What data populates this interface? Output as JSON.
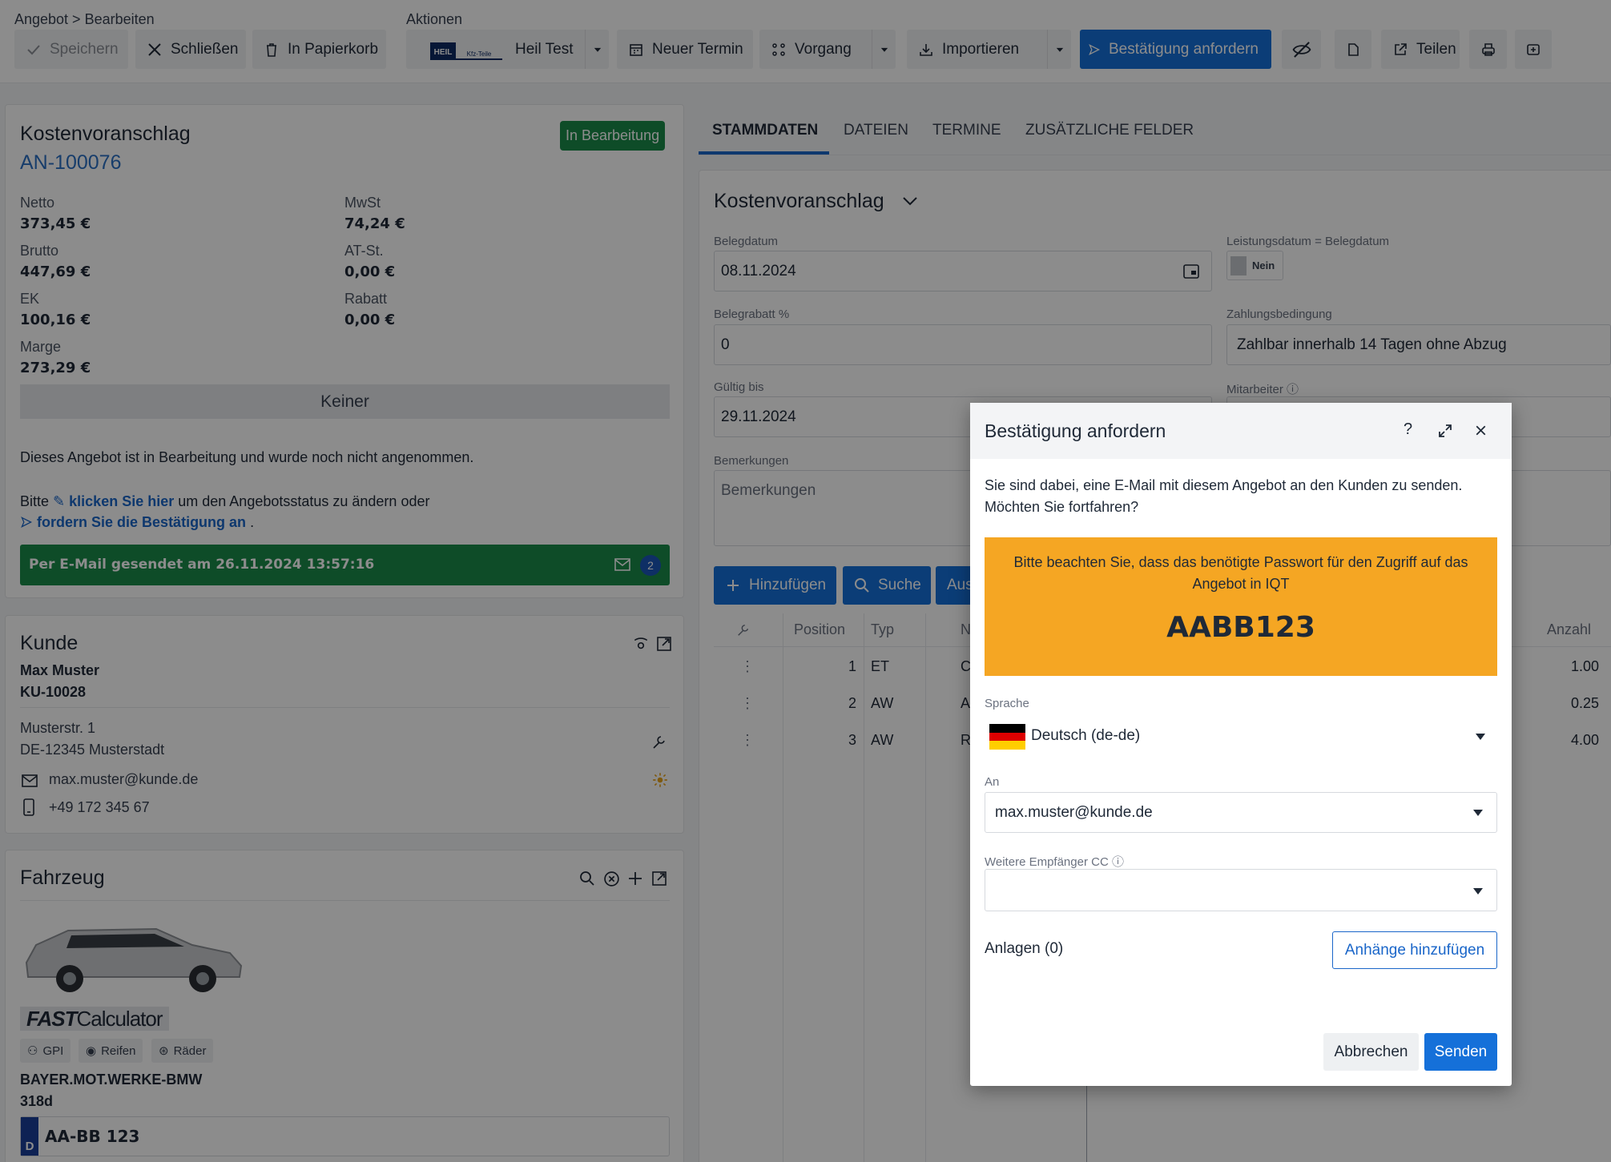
{
  "breadcrumb": "Angebot > Bearbeiten",
  "actions_label": "Aktionen",
  "toolbar": {
    "save": "Speichern",
    "close": "Schließen",
    "trash": "In Papierkorb",
    "heil_test": "Heil Test",
    "heil_logo_top": "HEIL",
    "heil_logo_bottom": "Kfz-Teile",
    "new_appointment": "Neuer Termin",
    "process": "Vorgang",
    "import": "Importieren",
    "request_confirmation": "Bestätigung anfordern",
    "share": "Teilen"
  },
  "summary": {
    "title": "Kostenvoranschlag",
    "number": "AN-100076",
    "status_badge": "In Bearbeitung",
    "netto_label": "Netto",
    "netto": "373,45 €",
    "mwst_label": "MwSt",
    "mwst": "74,24 €",
    "brutto_label": "Brutto",
    "brutto": "447,69 €",
    "atst_label": "AT-St.",
    "atst": "0,00 €",
    "ek_label": "EK",
    "ek": "100,16 €",
    "rabatt_label": "Rabatt",
    "rabatt": "0,00 €",
    "marge_label": "Marge",
    "marge": "273,29 €",
    "gray_bar": "Keiner",
    "info_text": "Dieses Angebot ist in Bearbeitung und wurde noch nicht angenommen.",
    "bitte": "Bitte",
    "click_here": "klicken Sie hier",
    "change_status": "um den Angebotsstatus zu ändern oder",
    "request_link": "fordern Sie die Bestätigung an",
    "dot": ".",
    "email_sent": "Per E-Mail gesendet am 26.11.2024 13:57:16",
    "email_count": "2"
  },
  "customer": {
    "title": "Kunde",
    "name": "Max Muster",
    "number": "KU-10028",
    "street": "Musterstr. 1",
    "city": "DE-12345 Musterstadt",
    "email": "max.muster@kunde.de",
    "phone": "+49 172 345 67"
  },
  "vehicle": {
    "title": "Fahrzeug",
    "fast_bold": "FAST",
    "fast_rest": " Calculator",
    "chip_gpi": "GPI",
    "chip_reifen": "Reifen",
    "chip_raeder": "Räder",
    "make": "BAYER.MOT.WERKE-BMW",
    "model": "318d",
    "plate_country": "D",
    "plate": "AA-BB 123"
  },
  "tabs": [
    "STAMMDATEN",
    "DATEIEN",
    "TERMINE",
    "ZUSÄTZLICHE FELDER"
  ],
  "form": {
    "title": "Kostenvoranschlag",
    "belegdatum_label": "Belegdatum",
    "belegdatum": "08.11.2024",
    "leistungsdatum_label": "Leistungsdatum = Belegdatum",
    "leistungsdatum_toggle": "Nein",
    "belegrabatt_label": "Belegrabatt %",
    "belegrabatt": "0",
    "zahlung_label": "Zahlungsbedingung",
    "zahlung": "Zahlbar innerhalb 14 Tagen ohne Abzug",
    "gueltig_label": "Gültig bis",
    "gueltig": "29.11.2024",
    "mitarbeiter_label": "Mitarbeiter",
    "bemerkungen_label": "Bemerkungen",
    "bemerkungen_placeholder": "Bemerkungen",
    "add_button": "Hinzufügen",
    "search_button": "Suche",
    "third_button": "Aus"
  },
  "table": {
    "col_position": "Position",
    "col_typ": "Typ",
    "col_n": "N",
    "col_anzahl": "Anzahl",
    "rows": [
      {
        "pos": "1",
        "typ": "ET",
        "n": "C",
        "anzahl": "1.00"
      },
      {
        "pos": "2",
        "typ": "AW",
        "n": "A",
        "anzahl": "0.25"
      },
      {
        "pos": "3",
        "typ": "AW",
        "n": "R",
        "anzahl": "4.00"
      }
    ]
  },
  "dialog": {
    "title": "Bestätigung anfordern",
    "help": "?",
    "message": "Sie sind dabei, eine E-Mail mit diesem Angebot an den Kunden zu senden. Möchten Sie fortfahren?",
    "warning": "Bitte beachten Sie, dass das benötigte Passwort für den Zugriff auf das Angebot in IQT",
    "password": "AABB123",
    "language_label": "Sprache",
    "language": "Deutsch (de-de)",
    "to_label": "An",
    "to": "max.muster@kunde.de",
    "cc_label": "Weitere Empfänger CC",
    "attachments": "Anlagen (0)",
    "add_attachments": "Anhänge hinzufügen",
    "cancel": "Abbrechen",
    "send": "Senden"
  },
  "colors": {
    "primary": "#1570d9",
    "status_green": "#1a8a4a",
    "warning_orange": "#f5a623"
  }
}
